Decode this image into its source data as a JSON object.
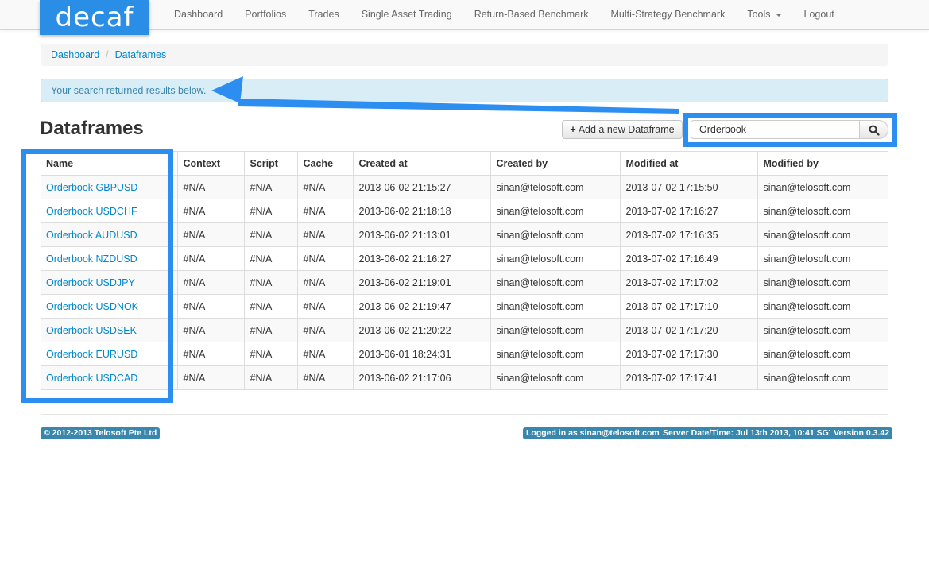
{
  "brand": "decaf",
  "nav": {
    "items": [
      "Dashboard",
      "Portfolios",
      "Trades",
      "Single Asset Trading",
      "Return-Based Benchmark",
      "Multi-Strategy Benchmark",
      "Tools",
      "Logout"
    ]
  },
  "breadcrumb": {
    "items": [
      "Dashboard",
      "Dataframes"
    ],
    "separator": "/"
  },
  "alert": {
    "text": "Your search returned results below."
  },
  "page_title": "Dataframes",
  "add_button_label": "Add a new Dataframe",
  "search": {
    "value": "Orderbook"
  },
  "table": {
    "columns": [
      "Name",
      "Context",
      "Script",
      "Cache",
      "Created at",
      "Created by",
      "Modified at",
      "Modified by"
    ],
    "rows": [
      [
        "Orderbook GBPUSD",
        "#N/A",
        "#N/A",
        "#N/A",
        "2013-06-02 21:15:27",
        "sinan@telosoft.com",
        "2013-07-02 17:15:50",
        "sinan@telosoft.com"
      ],
      [
        "Orderbook USDCHF",
        "#N/A",
        "#N/A",
        "#N/A",
        "2013-06-02 21:18:18",
        "sinan@telosoft.com",
        "2013-07-02 17:16:27",
        "sinan@telosoft.com"
      ],
      [
        "Orderbook AUDUSD",
        "#N/A",
        "#N/A",
        "#N/A",
        "2013-06-02 21:13:01",
        "sinan@telosoft.com",
        "2013-07-02 17:16:35",
        "sinan@telosoft.com"
      ],
      [
        "Orderbook NZDUSD",
        "#N/A",
        "#N/A",
        "#N/A",
        "2013-06-02 21:16:27",
        "sinan@telosoft.com",
        "2013-07-02 17:16:49",
        "sinan@telosoft.com"
      ],
      [
        "Orderbook USDJPY",
        "#N/A",
        "#N/A",
        "#N/A",
        "2013-06-02 21:19:01",
        "sinan@telosoft.com",
        "2013-07-02 17:17:02",
        "sinan@telosoft.com"
      ],
      [
        "Orderbook USDNOK",
        "#N/A",
        "#N/A",
        "#N/A",
        "2013-06-02 21:19:47",
        "sinan@telosoft.com",
        "2013-07-02 17:17:10",
        "sinan@telosoft.com"
      ],
      [
        "Orderbook USDSEK",
        "#N/A",
        "#N/A",
        "#N/A",
        "2013-06-02 21:20:22",
        "sinan@telosoft.com",
        "2013-07-02 17:17:20",
        "sinan@telosoft.com"
      ],
      [
        "Orderbook EURUSD",
        "#N/A",
        "#N/A",
        "#N/A",
        "2013-06-01 18:24:31",
        "sinan@telosoft.com",
        "2013-07-02 17:17:30",
        "sinan@telosoft.com"
      ],
      [
        "Orderbook USDCAD",
        "#N/A",
        "#N/A",
        "#N/A",
        "2013-06-02 21:17:06",
        "sinan@telosoft.com",
        "2013-07-02 17:17:41",
        "sinan@telosoft.com"
      ]
    ]
  },
  "footer": {
    "copyright": "© 2012-2013 Telosoft Pte Ltd",
    "logged_in": "Logged in as sinan@telosoft.com",
    "server_time": "Server Date/Time: Jul 13th 2013, 10:41 SGT",
    "version": "Version 0.3.42"
  },
  "icons": {
    "add": "plus-icon",
    "search": "search-icon",
    "tools_menu": "caret-down-icon"
  },
  "colors": {
    "brand": "#2b8ee6",
    "link": "#0088cc",
    "alert_bg": "#d9edf7",
    "label_bg": "#3a87ad",
    "annotation": "#2c8ef0"
  }
}
